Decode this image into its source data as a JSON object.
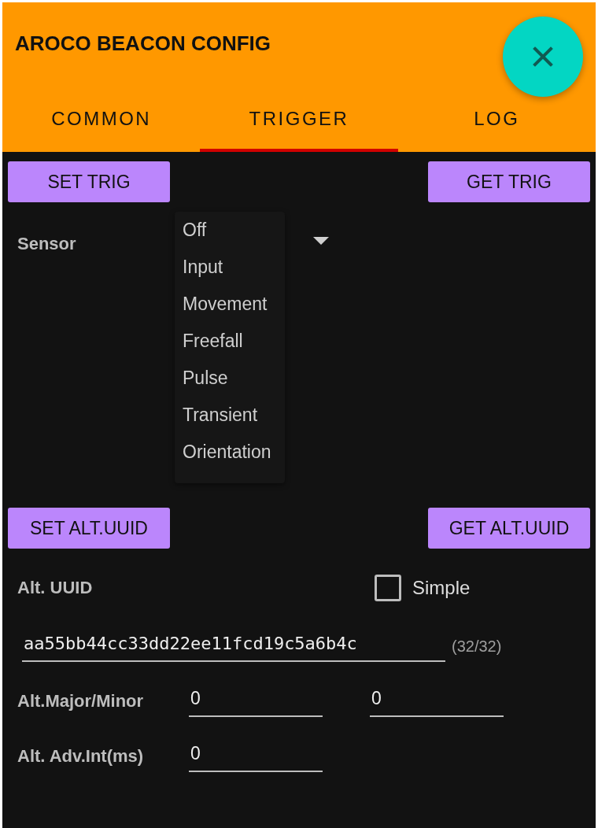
{
  "app_bar": {
    "title": "AROCO BEACON CONFIG"
  },
  "tabs": [
    {
      "label": "COMMON",
      "selected": false
    },
    {
      "label": "TRIGGER",
      "selected": true
    },
    {
      "label": "LOG",
      "selected": false
    }
  ],
  "trigger_buttons": [
    "SET TRIG",
    "GET TRIG"
  ],
  "sensor": {
    "label": "Sensor",
    "expanded": true,
    "options": [
      "Off",
      "Input",
      "Movement",
      "Freefall",
      "Pulse",
      "Transient",
      "Orientation"
    ]
  },
  "alt_uuid_buttons": [
    "SET ALT.UUID",
    "GET ALT.UUID"
  ],
  "alt_uuid": {
    "label": "Alt. UUID",
    "simple": {
      "label": "Simple",
      "checked": false
    },
    "value": "aa55bb44cc33dd22ee11fcd19c5a6b4c",
    "counter": "(32/32)"
  },
  "major_minor": {
    "label": "Alt.Major/Minor",
    "major": "0",
    "minor": "0"
  },
  "adv_interval": {
    "label": "Alt. Adv.Int(ms)",
    "value": "0"
  }
}
